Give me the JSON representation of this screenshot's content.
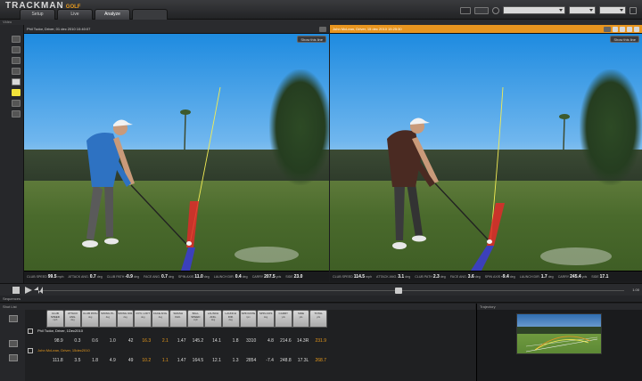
{
  "app": {
    "logo": "TRACKMAN",
    "logo_accent": "GOLF",
    "subtitle": "Video"
  },
  "tabs": [
    {
      "label": "Setup"
    },
    {
      "label": "Live"
    },
    {
      "label": "Analyze"
    }
  ],
  "left_pane": {
    "title": "Phil Tudor, Driver, 01 dec 2010 10:40:07",
    "overlay_button": "Show this line",
    "stats": [
      {
        "label": "CLUB SPEED",
        "value": "99.5",
        "unit": "mph"
      },
      {
        "label": "ATTACK ANG.",
        "value": "0.7",
        "unit": "deg"
      },
      {
        "label": "CLUB PATH",
        "value": "-0.9",
        "unit": "deg"
      },
      {
        "label": "FACE ANG.",
        "value": "0.7",
        "unit": "deg"
      },
      {
        "label": "SPIN AXIS",
        "value": "11.0",
        "unit": "deg"
      },
      {
        "label": "LAUNCH DIR.",
        "value": "0.4",
        "unit": "deg"
      },
      {
        "label": "CARRY",
        "value": "207.5",
        "unit": "yds"
      },
      {
        "label": "SIDE",
        "value": "23.0",
        "unit": ""
      }
    ]
  },
  "right_pane": {
    "title": "John McLean, Driver, 15 dec 2010 15:25:30",
    "overlay_button": "Show this line",
    "stats": [
      {
        "label": "CLUB SPEED",
        "value": "114.5",
        "unit": "mph"
      },
      {
        "label": "ATTACK ANG.",
        "value": "3.1",
        "unit": "deg"
      },
      {
        "label": "CLUB PATH",
        "value": "2.3",
        "unit": "deg"
      },
      {
        "label": "FACE ANG.",
        "value": "3.6",
        "unit": "deg"
      },
      {
        "label": "SPIN AXIS",
        "value": "-9.4",
        "unit": "deg"
      },
      {
        "label": "LAUNCH DIR.",
        "value": "1.7",
        "unit": "deg"
      },
      {
        "label": "CARRY",
        "value": "245.4",
        "unit": "yds"
      },
      {
        "label": "SIDE",
        "value": "17.1",
        "unit": ""
      }
    ]
  },
  "timeline": {
    "end_value": "1.00"
  },
  "sequences_label": "Sequences",
  "shotlist": {
    "title": "Shot List",
    "columns": [
      {
        "name": "CLUB SPEED",
        "unit": "mph"
      },
      {
        "name": "ATTACK ANG.",
        "unit": "deg"
      },
      {
        "name": "CLUB PATH",
        "unit": "deg"
      },
      {
        "name": "SWING PL.",
        "unit": "deg"
      },
      {
        "name": "SWING DIR.",
        "unit": "deg"
      },
      {
        "name": "DYN. LOFT",
        "unit": "deg"
      },
      {
        "name": "FACE ANG.",
        "unit": "deg"
      },
      {
        "name": "SMASH FAC.",
        "unit": ""
      },
      {
        "name": "BALL SPEED",
        "unit": "mph"
      },
      {
        "name": "LAUNCH ANG.",
        "unit": "deg"
      },
      {
        "name": "LAUNCH DIR.",
        "unit": "deg"
      },
      {
        "name": "SPIN RATE",
        "unit": "rpm"
      },
      {
        "name": "SPIN AXIS",
        "unit": "deg"
      },
      {
        "name": "CARRY",
        "unit": "yds"
      },
      {
        "name": "SIDE",
        "unit": "yds"
      },
      {
        "name": "TOTAL",
        "unit": "yds"
      }
    ],
    "rows": [
      {
        "label": "Phil Tudor, Driver, 1Dec2010",
        "values": [
          "98.9",
          "0.3",
          "0.6",
          "1.0",
          "42",
          "16.3",
          "2.1",
          "1.47",
          "145.2",
          "14.1",
          "1.8",
          "3310",
          "4.8",
          "214.6",
          "14.3R",
          "231.9"
        ]
      },
      {
        "label": "John McLean, Driver, 15dec2010",
        "values": [
          "111.8",
          "3.5",
          "1.8",
          "4.9",
          "49",
          "10.2",
          "1.1",
          "1.47",
          "164.5",
          "12.1",
          "1.3",
          "2854",
          "-7.4",
          "248.8",
          "17.3L",
          "268.7"
        ]
      }
    ],
    "highlight_columns": [
      5,
      6,
      15
    ]
  },
  "trajectory": {
    "title": "Trajectory"
  },
  "colors": {
    "accent": "#e8951f",
    "club_path": "#e02a2a",
    "ball_path": "#3b3bd6",
    "trace": "#f2ec54"
  }
}
